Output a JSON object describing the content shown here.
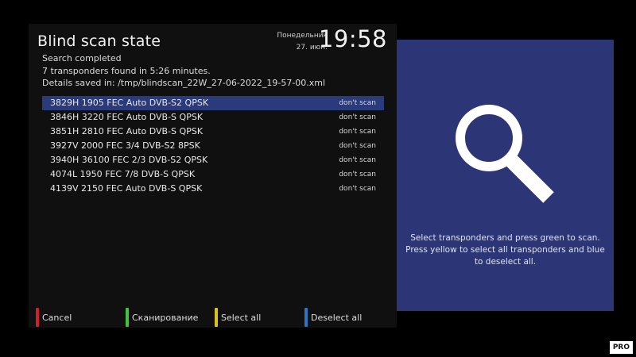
{
  "header": {
    "title": "Blind scan state",
    "weekday": "Понедельник",
    "date": "27. июн.",
    "time": "19:58"
  },
  "info": {
    "line1": "Search completed",
    "line2": "7 transponders found in 5:26 minutes.",
    "line3": "Details saved in: /tmp/blindscan_22W_27-06-2022_19-57-00.xml"
  },
  "transponders": [
    {
      "label": "3829H 1905 FEC Auto DVB-S2 QPSK",
      "status": "don't scan",
      "selected": true
    },
    {
      "label": "3846H 3220 FEC Auto DVB-S QPSK",
      "status": "don't scan"
    },
    {
      "label": "3851H 2810 FEC Auto DVB-S QPSK",
      "status": "don't scan"
    },
    {
      "label": "3927V 2000 FEC 3/4 DVB-S2 8PSK",
      "status": "don't scan"
    },
    {
      "label": "3940H 36100 FEC 2/3 DVB-S2 QPSK",
      "status": "don't scan"
    },
    {
      "label": "4074L 1950 FEC 7/8 DVB-S QPSK",
      "status": "don't scan"
    },
    {
      "label": "4139V 2150 FEC Auto DVB-S QPSK",
      "status": "don't scan"
    }
  ],
  "buttons": {
    "red": {
      "label": "Cancel",
      "color": "#d0202a"
    },
    "green": {
      "label": "Сканирование",
      "color": "#3fc53a"
    },
    "yellow": {
      "label": "Select all",
      "color": "#d8c21e"
    },
    "blue": {
      "label": "Deselect all",
      "color": "#2b76c9"
    }
  },
  "help": {
    "text": "Select transponders and press green to scan. Press yellow to select all transponders and blue to deselect all.",
    "icon": "magnifier-icon"
  },
  "watermark": {
    "text": "PRO"
  },
  "colors": {
    "selection": "#2b3a7a",
    "panel": "#2c3677"
  }
}
